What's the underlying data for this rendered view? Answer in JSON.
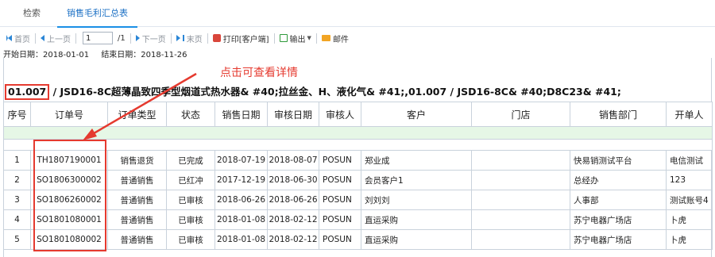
{
  "tabs": [
    {
      "label": "检索",
      "active": false
    },
    {
      "label": "销售毛利汇总表",
      "active": true
    }
  ],
  "toolbar": {
    "first": "首页",
    "prev": "上一页",
    "page_value": "1",
    "page_total": "/1",
    "next": "下一页",
    "last": "末页",
    "print": "打印[客户端]",
    "export": "输出",
    "mail": "邮件"
  },
  "dates": {
    "start": "开始日期：2018-01-01",
    "end": "结束日期：2018-11-26"
  },
  "annotation": {
    "hint": "点击可查看详情",
    "color": "#e53a2f"
  },
  "product": {
    "code": "01.007",
    "rest": "/ JSD16-8C超薄晶致四季型烟道式热水器& #40;拉丝金、H、液化气& #41;,01.007 / JSD16-8C& #40;D8C23& #41;"
  },
  "table": {
    "headers": [
      "序号",
      "订单号",
      "订单类型",
      "状态",
      "销售日期",
      "审核日期",
      "审核人",
      "客户",
      "门店",
      "销售部门",
      "开单人"
    ],
    "rows": [
      {
        "no": "1",
        "order": "TH1807190001",
        "type": "销售退货",
        "status": "已完成",
        "sale_date": "2018-07-19",
        "audit_date": "2018-08-07",
        "auditor": "POSUN",
        "customer": "郑业成",
        "store": "",
        "dept": "快易销测试平台",
        "creator": "电信测试"
      },
      {
        "no": "2",
        "order": "SO1806300002",
        "type": "普通销售",
        "status": "已红冲",
        "sale_date": "2017-12-19",
        "audit_date": "2018-06-30",
        "auditor": "POSUN",
        "customer": "会员客户1",
        "store": "",
        "dept": "总经办",
        "creator": "123"
      },
      {
        "no": "3",
        "order": "SO1806260002",
        "type": "普通销售",
        "status": "已审核",
        "sale_date": "2018-06-26",
        "audit_date": "2018-06-26",
        "auditor": "POSUN",
        "customer": "刘刘刘",
        "store": "",
        "dept": "人事部",
        "creator": "测试账号4"
      },
      {
        "no": "4",
        "order": "SO1801080001",
        "type": "普通销售",
        "status": "已审核",
        "sale_date": "2018-01-08",
        "audit_date": "2018-02-12",
        "auditor": "POSUN",
        "customer": "直运采购",
        "store": "",
        "dept": "苏宁电器广场店",
        "creator": "卜虎"
      },
      {
        "no": "5",
        "order": "SO1801080002",
        "type": "普通销售",
        "status": "已审核",
        "sale_date": "2018-01-08",
        "audit_date": "2018-02-12",
        "auditor": "POSUN",
        "customer": "直运采购",
        "store": "",
        "dept": "苏宁电器广场店",
        "creator": "卜虎"
      }
    ]
  }
}
